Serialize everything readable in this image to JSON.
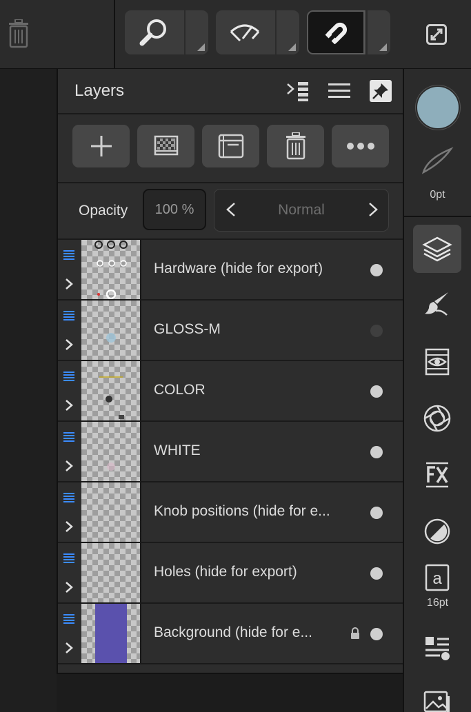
{
  "panel": {
    "title": "Layers",
    "opacity_label": "Opacity",
    "opacity_value": "100 %",
    "blend_mode": "Normal"
  },
  "layers": [
    {
      "name": "Hardware (hide for export)",
      "visible": true,
      "locked": false
    },
    {
      "name": "GLOSS-M",
      "visible": false,
      "locked": false
    },
    {
      "name": "COLOR",
      "visible": true,
      "locked": false
    },
    {
      "name": "WHITE",
      "visible": true,
      "locked": false
    },
    {
      "name": "Knob positions (hide for e...",
      "visible": true,
      "locked": false
    },
    {
      "name": "Holes (hide for export)",
      "visible": true,
      "locked": false
    },
    {
      "name": "Background (hide for e...",
      "visible": true,
      "locked": true
    }
  ],
  "rightbar": {
    "stroke_width": "0pt",
    "text_size": "16pt",
    "fill_color": "#8eaebb"
  },
  "icons": [
    "trash-icon",
    "zoom-icon",
    "view-mode-icon",
    "snapping-magnet-icon",
    "fullscreen-icon",
    "layer-options-icon",
    "list-icon",
    "pin-icon",
    "add-layer-icon",
    "mask-icon",
    "group-icon",
    "delete-icon",
    "more-icon",
    "layers-icon",
    "brushes-icon",
    "adjustments-icon",
    "effects-icon",
    "fx-icon",
    "styles-icon",
    "text-styles-icon",
    "stock-icon",
    "image-icon"
  ],
  "colors": {
    "background_layer_fill": "#5a51ad",
    "accent_handle": "#3b8cff"
  }
}
